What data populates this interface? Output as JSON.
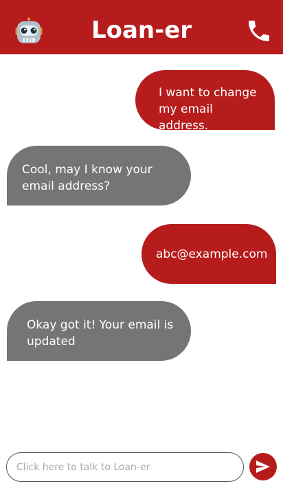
{
  "header": {
    "title": "Loan-er",
    "bot_icon": "robot-face-icon",
    "call_icon": "phone-icon"
  },
  "messages": [
    {
      "sender": "user",
      "text": "I want to change my email address."
    },
    {
      "sender": "bot",
      "text": "Cool, may I know your email address?"
    },
    {
      "sender": "user",
      "text": "abc@example.com"
    },
    {
      "sender": "bot",
      "text": "Okay got it! Your email is updated"
    }
  ],
  "composer": {
    "value": "",
    "placeholder": "Click here to talk to Loan-er",
    "send_icon": "send-icon"
  },
  "colors": {
    "brand": "#b71c1c",
    "bot_bubble": "#757575",
    "background": "#ffffff"
  }
}
